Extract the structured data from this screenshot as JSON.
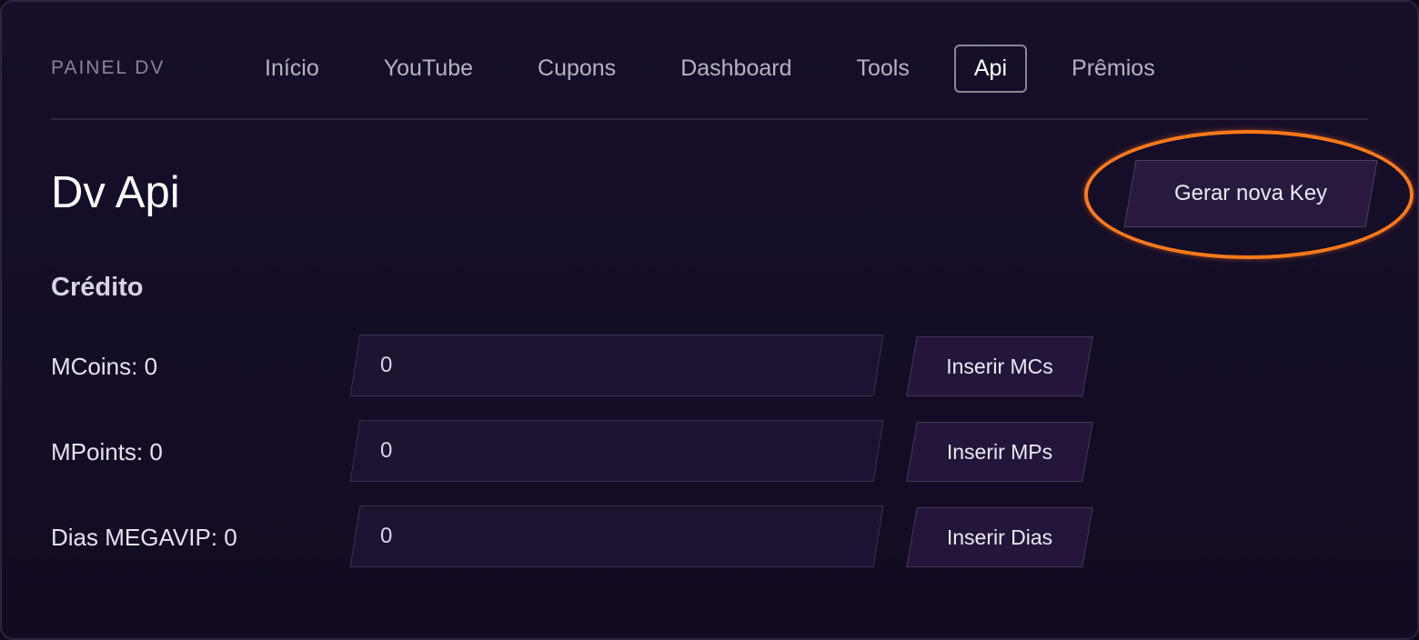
{
  "nav": {
    "brand": "PAINEL DV",
    "items": [
      {
        "label": "Início"
      },
      {
        "label": "YouTube"
      },
      {
        "label": "Cupons"
      },
      {
        "label": "Dashboard"
      },
      {
        "label": "Tools"
      },
      {
        "label": "Api",
        "active": true
      },
      {
        "label": "Prêmios"
      }
    ]
  },
  "page": {
    "title": "Dv Api",
    "generate_button": "Gerar nova Key"
  },
  "credit": {
    "title": "Crédito",
    "rows": [
      {
        "label": "MCoins: 0",
        "value": "0",
        "button": "Inserir MCs"
      },
      {
        "label": "MPoints: 0",
        "value": "0",
        "button": "Inserir MPs"
      },
      {
        "label": "Dias MEGAVIP: 0",
        "value": "0",
        "button": "Inserir Dias"
      }
    ]
  },
  "colors": {
    "highlight": "#ff7a1a",
    "background": "#170f2a",
    "button": "#28193e"
  }
}
